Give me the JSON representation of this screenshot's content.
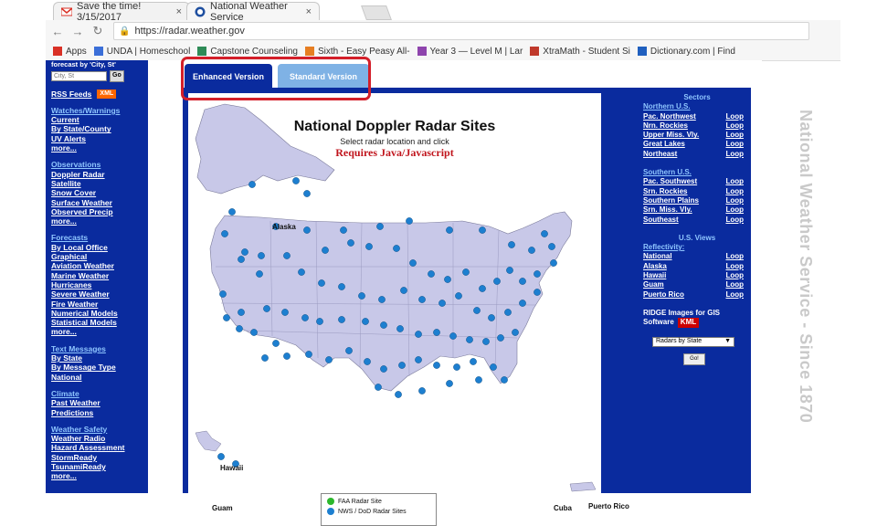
{
  "browser": {
    "tabs": [
      {
        "title": "Save the time! 3/15/2017",
        "favicon": "gmail-icon"
      },
      {
        "title": "National Weather Service",
        "favicon": "nws-icon"
      }
    ],
    "close_glyph": "×",
    "url": "https://radar.weather.gov",
    "bookmarks": [
      {
        "label": "Apps",
        "icon": "apps-icon",
        "color": "#d93025"
      },
      {
        "label": "UNDA | Homeschool",
        "icon": "page-icon",
        "color": "#3b6fd8"
      },
      {
        "label": "Capstone Counseling",
        "icon": "page-icon",
        "color": "#2e8b57"
      },
      {
        "label": "Sixth - Easy Peasy All-",
        "icon": "page-icon",
        "color": "#e67e22"
      },
      {
        "label": "Year 3 — Level M | Lar",
        "icon": "page-icon",
        "color": "#8e44ad"
      },
      {
        "label": "XtraMath - Student Si",
        "icon": "page-icon",
        "color": "#c0392b"
      },
      {
        "label": "Dictionary.com | Find",
        "icon": "page-icon",
        "color": "#1f5fbf"
      }
    ]
  },
  "leftnav": {
    "top": {
      "forecast_label": "forecast by 'City, St'",
      "city_placeholder": "City, St"
    },
    "rss": "RSS Feeds",
    "xml": "XML",
    "sections": [
      {
        "title": "Watches/Warnings",
        "items": [
          "Current",
          "By State/County",
          "UV Alerts",
          "more..."
        ]
      },
      {
        "title": "Observations",
        "items": [
          "Doppler Radar",
          "Satellite",
          "Snow Cover",
          "Surface Weather",
          "Observed Precip",
          "more..."
        ]
      },
      {
        "title": "Forecasts",
        "items": [
          "By Local Office",
          "Graphical",
          "Aviation Weather",
          "Marine Weather",
          "Hurricanes",
          "Severe Weather",
          "Fire Weather",
          "Numerical Models",
          "Statistical Models",
          "more..."
        ]
      },
      {
        "title": "Text Messages",
        "items": [
          "By State",
          "By Message Type",
          "National"
        ]
      },
      {
        "title": "Climate",
        "items": [
          "Past Weather",
          "Predictions"
        ]
      },
      {
        "title": "Weather Safety",
        "items": [
          "Weather Radio",
          "Hazard Assessment",
          "StormReady",
          "TsunamiReady",
          "more..."
        ]
      }
    ]
  },
  "view_tabs": {
    "enhanced": "Enhanced Version",
    "standard": "Standard Version"
  },
  "map": {
    "title": "National Doppler Radar Sites",
    "subtitle": "Select radar location and click",
    "requirement": "Requires Java/Javascript",
    "labels": {
      "alaska": "Alaska",
      "hawaii": "Hawaii",
      "guam": "Guam",
      "cuba": "Cuba",
      "puerto_rico": "Puerto Rico"
    },
    "colors": {
      "land": "#c8c8e8",
      "water": "#ffffff",
      "nws_site": "#1d7fd0",
      "faa_site": "#2db82d"
    },
    "legend": [
      {
        "label": "FAA Radar Site",
        "color": "#2db82d"
      },
      {
        "label": "NWS / DoD Radar Sites",
        "color": "#1d7fd0"
      }
    ]
  },
  "sectors": {
    "heading": "Sectors",
    "northern_title": "Northern U.S.",
    "northern": [
      "Pac. Northwest",
      "Nrn. Rockies",
      "Upper Miss. Vly.",
      "Great Lakes",
      "Northeast"
    ],
    "southern_title": "Southern U.S.",
    "southern": [
      "Pac. Southwest",
      "Srn. Rockies",
      "Southern Plains",
      "Srn. Miss. Vly.",
      "Southeast"
    ],
    "us_views_title": "U.S. Views",
    "reflectivity_label": "Reflectivity:",
    "views": [
      "National",
      "Alaska",
      "Hawaii",
      "Guam",
      "Puerto Rico"
    ],
    "loop_label": "Loop",
    "ridge_label": "RIDGE Images for GIS",
    "software_label": "Software",
    "kml": "KML",
    "select_value": "Radars by State",
    "go_label": "Go!"
  },
  "side_banner": "National Weather Service - Since 1870"
}
